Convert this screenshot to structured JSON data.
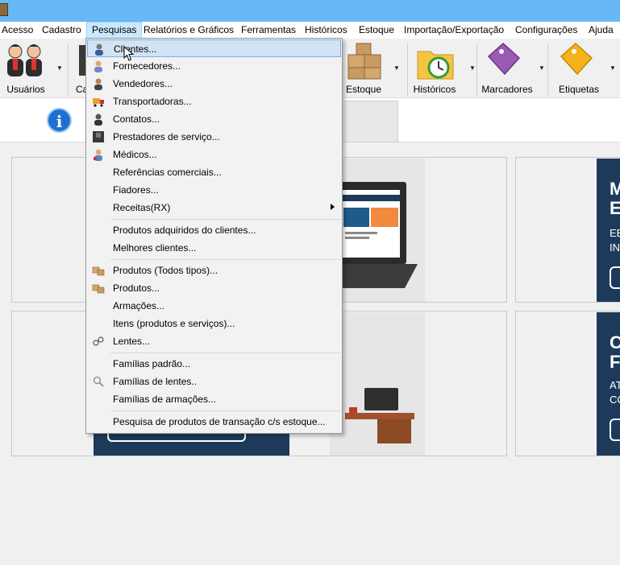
{
  "menubar": {
    "items": [
      "Acesso",
      "Cadastro",
      "Pesquisas",
      "Relatórios e Gráficos",
      "Ferramentas",
      "Históricos",
      "Estoque",
      "Importação/Exportação",
      "Configurações",
      "Ajuda"
    ],
    "active": "Pesquisas"
  },
  "toolbar": {
    "usuarios": "Usuários",
    "cadastro_partial": "Ca",
    "estoque": "Estoque",
    "historicos": "Históricos",
    "marcadores": "Marcadores",
    "etiquetas": "Etiquetas"
  },
  "banners": {
    "top_right_partial": [
      "M",
      "E",
      "EE",
      "IN"
    ],
    "bottom_right_partial": [
      "C",
      "F",
      "AT",
      "CO"
    ]
  },
  "dropdown": {
    "items": [
      {
        "label": "Clientes...",
        "icon": "person-icon",
        "hover": true
      },
      {
        "label": "Fornecedores...",
        "icon": "person-icon"
      },
      {
        "label": "Vendedores...",
        "icon": "person-icon"
      },
      {
        "label": "Transportadoras...",
        "icon": "truck-icon"
      },
      {
        "label": "Contatos...",
        "icon": "contact-icon"
      },
      {
        "label": "Prestadores de serviço...",
        "icon": "worker-icon"
      },
      {
        "label": "Médicos...",
        "icon": "doctor-icon"
      },
      {
        "label": "Referências comerciais..."
      },
      {
        "label": "Fiadores..."
      },
      {
        "label": "Receitas(RX)",
        "submenu": true
      },
      {
        "label": "Produtos adquiridos do clientes..."
      },
      {
        "label": "Melhores clientes..."
      },
      {
        "label": "Produtos (Todos tipos)...",
        "icon": "box-icon"
      },
      {
        "label": "Produtos...",
        "icon": "box-icon"
      },
      {
        "label": "Armações..."
      },
      {
        "label": "Itens (produtos e serviços)..."
      },
      {
        "label": "Lentes...",
        "icon": "glasses-icon"
      },
      {
        "label": "Famílias padrão..."
      },
      {
        "label": "Famílias de lentes..",
        "icon": "magnifier-icon"
      },
      {
        "label": "Famílias de armações..."
      },
      {
        "label": "Pesquisa de produtos de transação c/s estoque..."
      }
    ]
  },
  "colors": {
    "titlebar": "#66b8f7",
    "menu_active": "#cce8ff",
    "dropdown_hover": "#d1e3f5",
    "banner_dark": "#1e3a5a"
  }
}
